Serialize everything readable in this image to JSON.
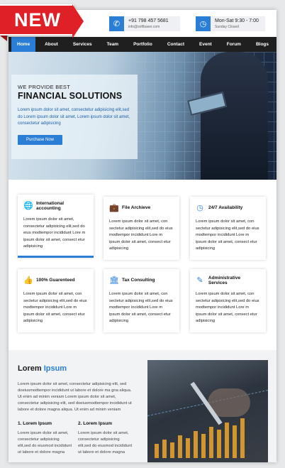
{
  "badge": "NEW",
  "header": {
    "phone": "+91 798 457 5681",
    "email": "info@softbaser.com",
    "hours": "Mon-Sat 9:30 - 7:00",
    "closed": "Sunday Closed",
    "phone_icon": "phone-icon",
    "clock_icon": "clock-icon"
  },
  "nav": [
    "Home",
    "About",
    "Services",
    "Team",
    "Portfolio",
    "Contact",
    "Event",
    "Forum",
    "Blogs"
  ],
  "hero": {
    "kicker": "WE PROVIDE BEST",
    "title": "FINANCIAL SOLUTIONS",
    "description": "Lorem ipsum dolor sit amet, consectetur adipisicing elit,sed do Lorem ipsum dolor sit amet, Lorem ipsum dolor sit amet, consectetur adipisicing",
    "button": "Purchase Now"
  },
  "services": [
    {
      "icon": "globe-icon",
      "title": "International accounting",
      "body": "Lorem ipsum dolor sit amet, consectetur adipisicing elit,sed do eius modtempor incididunt Lore m ipsum dolor sit amet, consect etur adipisicing"
    },
    {
      "icon": "briefcase-icon",
      "title": "File Archieve",
      "body": "Lorem ipsum dolor sit amet, con sectetur adipisicing elit,sed do eius modtempor incididunt Lore m ipsum dolor sit amet, consect etur adipisicing"
    },
    {
      "icon": "clock-icon",
      "title": "24/7 Availability",
      "body": "Lorem ipsum dolor sit amet, con sectetur adipisicing elit,sed do eius modtempor incididunt Lore m ipsum dolor sit amet, consect etur adipisicing"
    },
    {
      "icon": "thumbs-up-icon",
      "title": "100% Guarenteed",
      "body": "Lorem ipsum dolor sit amet, con sectetur adipisicing elit,sed do eius modtempor incididunt Lore m ipsum dolor sit amet, consect etur adipisicing"
    },
    {
      "icon": "bank-icon",
      "title": "Tax Consulting",
      "body": "Lorem ipsum dolor sit amet, con sectetur adipisicing elit,sed do eius modtempor incididunt Lore m ipsum dolor sit amet, consect etur adipisicing"
    },
    {
      "icon": "pen-icon",
      "title": "Administrative Services",
      "body": "Lorem ipsum dolor sit amet, con sectetur adipisicing elit,sed do eius modtempor incididunt Lore m ipsum dolor sit amet, consect etur adipisicing"
    }
  ],
  "about": {
    "title_main": "Lorem",
    "title_accent": "Ipsum",
    "paragraph": "Lorem ipsum dolor sit amet, consectetur adipisicing elit, sed doeiusmodtempor incididunt ut labore et dolore ma gna aliqua. Ut enim ad minim veniam Lorem ipsum dolor sit amet, consectetur adipisicing elit, sed doeiusmodtempor incididunt ut labore et dolore magna aliqua. Ut enim ad minim veniam",
    "col1_title": "1. Lorem Ipsum",
    "col1_body": "Lorem ipsum dolor sit amet, consectetur adipisicing elit,sed do eiusmod incididunt ut labore et dolore magna",
    "col2_title": "2. Lorem Ipsum",
    "col2_body": "Lorem ipsum dolor sit amet, consectetur adipisicing elit,sed do eiusmod incididunt ut labore et dolore magna"
  },
  "colors": {
    "accent": "#2a7ed6",
    "ribbon": "#e02027",
    "nav": "#1f1f1f"
  }
}
